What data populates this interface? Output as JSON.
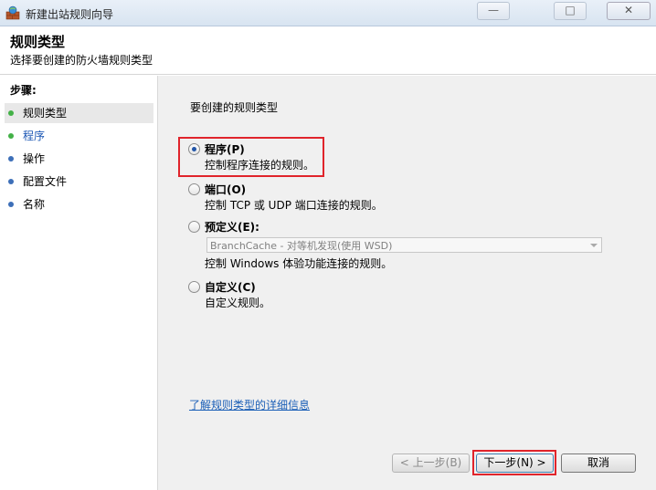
{
  "window": {
    "title": "新建出站规则向导",
    "close_glyph": "✕",
    "min_glyph": "—",
    "max_glyph": "□"
  },
  "header": {
    "title": "规则类型",
    "subtitle": "选择要创建的防火墙规则类型"
  },
  "sidebar": {
    "title": "步骤:",
    "steps": [
      {
        "label": "规则类型",
        "state": "current"
      },
      {
        "label": "程序",
        "state": "done"
      },
      {
        "label": "操作",
        "state": "pending"
      },
      {
        "label": "配置文件",
        "state": "pending"
      },
      {
        "label": "名称",
        "state": "pending"
      }
    ]
  },
  "main": {
    "question": "要创建的规则类型",
    "options": [
      {
        "label": "程序(P)",
        "description": "控制程序连接的规则。",
        "checked": true
      },
      {
        "label": "端口(O)",
        "description": "控制 TCP 或 UDP 端口连接的规则。",
        "checked": false
      },
      {
        "label": "预定义(E):",
        "description": "控制 Windows 体验功能连接的规则。",
        "checked": false
      },
      {
        "label": "自定义(C)",
        "description": "自定义规则。",
        "checked": false
      }
    ],
    "predefined_dropdown": {
      "selected": "BranchCache - 对等机发现(使用 WSD)"
    },
    "learn_more_link": "了解规则类型的详细信息"
  },
  "buttons": {
    "back": "< 上一步(B)",
    "next": "下一步(N) >",
    "cancel": "取消"
  },
  "colors": {
    "highlight": "#e0242b",
    "link": "#1b5fb7",
    "step_done_dot": "#43b147",
    "step_pending_dot": "#3d6fb8"
  }
}
